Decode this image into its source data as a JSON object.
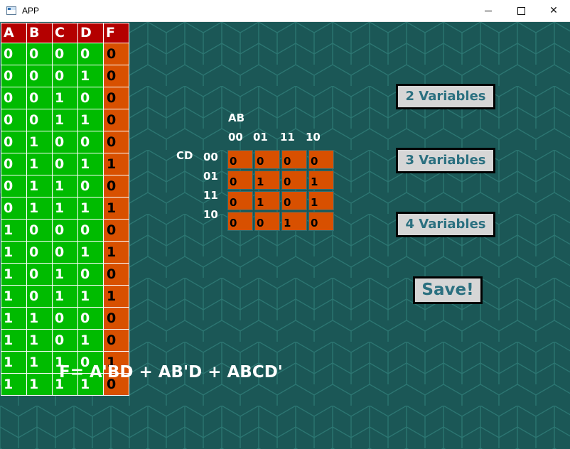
{
  "window": {
    "title": "APP",
    "minimize_label": "─",
    "maximize_label": "☐",
    "close_label": "✕"
  },
  "truth_table": {
    "headers": [
      "A",
      "B",
      "C",
      "D",
      "F"
    ],
    "rows": [
      [
        "0",
        "0",
        "0",
        "0",
        "0"
      ],
      [
        "0",
        "0",
        "0",
        "1",
        "0"
      ],
      [
        "0",
        "0",
        "1",
        "0",
        "0"
      ],
      [
        "0",
        "0",
        "1",
        "1",
        "0"
      ],
      [
        "0",
        "1",
        "0",
        "0",
        "0"
      ],
      [
        "0",
        "1",
        "0",
        "1",
        "1"
      ],
      [
        "0",
        "1",
        "1",
        "0",
        "0"
      ],
      [
        "0",
        "1",
        "1",
        "1",
        "1"
      ],
      [
        "1",
        "0",
        "0",
        "0",
        "0"
      ],
      [
        "1",
        "0",
        "0",
        "1",
        "1"
      ],
      [
        "1",
        "0",
        "1",
        "0",
        "0"
      ],
      [
        "1",
        "0",
        "1",
        "1",
        "1"
      ],
      [
        "1",
        "1",
        "0",
        "0",
        "0"
      ],
      [
        "1",
        "1",
        "0",
        "1",
        "0"
      ],
      [
        "1",
        "1",
        "1",
        "0",
        "1"
      ],
      [
        "1",
        "1",
        "1",
        "1",
        "0"
      ]
    ]
  },
  "kmap": {
    "col_var": "AB",
    "row_var": "CD",
    "col_headers": [
      "00",
      "01",
      "11",
      "10"
    ],
    "row_headers": [
      "00",
      "01",
      "11",
      "10"
    ],
    "cells": [
      [
        "0",
        "0",
        "0",
        "0"
      ],
      [
        "0",
        "1",
        "0",
        "1"
      ],
      [
        "0",
        "1",
        "0",
        "1"
      ],
      [
        "0",
        "0",
        "1",
        "0"
      ]
    ]
  },
  "buttons": {
    "two_vars": "2 Variables",
    "three_vars": "3 Variables",
    "four_vars": "4 Variables",
    "save": "Save!"
  },
  "formula": "F= A'BD + AB'D + ABCD'",
  "colors": {
    "background": "#1b5756",
    "header_red": "#b40000",
    "input_green": "#00bb00",
    "output_orange": "#d85000",
    "button_text": "#2b7080"
  }
}
